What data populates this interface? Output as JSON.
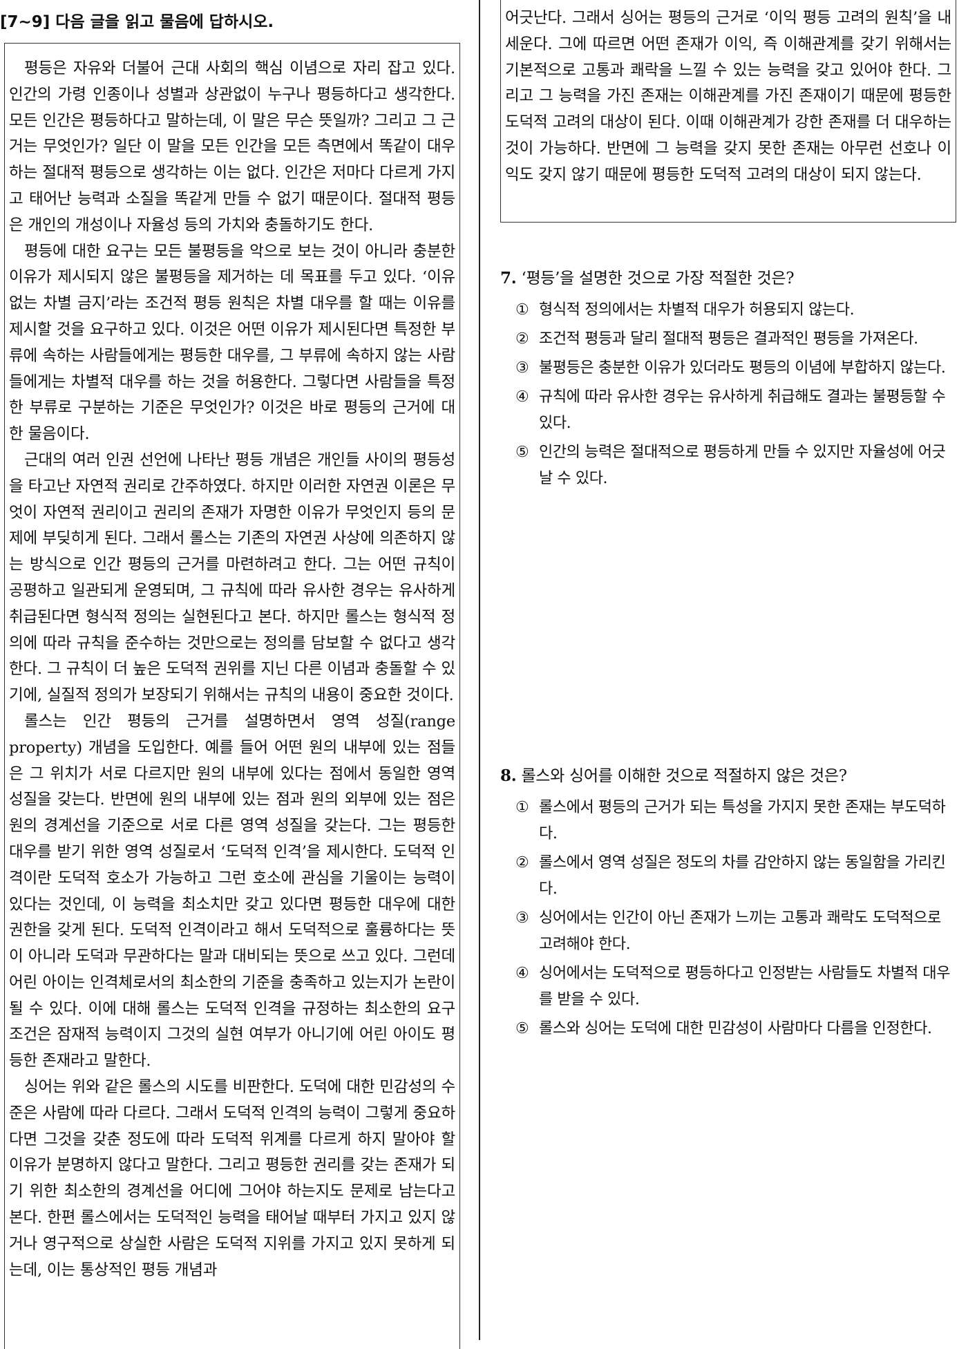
{
  "header": "[7~9] 다음 글을 읽고 물음에 답하시오.",
  "passage_left": [
    "평등은 자유와 더불어 근대 사회의 핵심 이념으로 자리 잡고 있다. 인간의 가령 인종이나 성별과 상관없이 누구나 평등하다고 생각한다. 모든 인간은 평등하다고 말하는데, 이 말은 무슨 뜻일까? 그리고 그 근거는 무엇인가? 일단 이 말을 모든 인간을 모든 측면에서 똑같이 대우하는 절대적 평등으로 생각하는 이는 없다. 인간은 저마다 다르게 가지고 태어난 능력과 소질을 똑같게 만들 수 없기 때문이다. 절대적 평등은 개인의 개성이나 자율성 등의 가치와 충돌하기도 한다.",
    "평등에 대한 요구는 모든 불평등을 악으로 보는 것이 아니라 충분한 이유가 제시되지 않은 불평등을 제거하는 데 목표를 두고 있다. ‘이유 없는 차별 금지’라는 조건적 평등 원칙은 차별 대우를 할 때는 이유를 제시할 것을 요구하고 있다. 이것은 어떤 이유가 제시된다면 특정한 부류에 속하는 사람들에게는 평등한 대우를, 그 부류에 속하지 않는 사람들에게는 차별적 대우를 하는 것을 허용한다. 그렇다면 사람들을 특정한 부류로 구분하는 기준은 무엇인가? 이것은 바로 평등의 근거에 대한 물음이다.",
    "근대의 여러 인권 선언에 나타난 평등 개념은 개인들 사이의 평등성을 타고난 자연적 권리로 간주하였다. 하지만 이러한 자연권 이론은 무엇이 자연적 권리이고 권리의 존재가 자명한 이유가 무엇인지 등의 문제에 부딪히게 된다. 그래서 롤스는 기존의 자연권 사상에 의존하지 않는 방식으로 인간 평등의 근거를 마련하려고 한다. 그는 어떤 규칙이 공평하고 일관되게 운영되며, 그 규칙에 따라 유사한 경우는 유사하게 취급된다면 형식적 정의는 실현된다고 본다. 하지만 롤스는 형식적 정의에 따라 규칙을 준수하는 것만으로는 정의를 담보할 수 없다고 생각한다. 그 규칙이 더 높은 도덕적 권위를 지닌 다른 이념과 충돌할 수 있기에, 실질적 정의가 보장되기 위해서는 규칙의 내용이 중요한 것이다.",
    "롤스는 인간 평등의 근거를 설명하면서 영역 성질(range property) 개념을 도입한다. 예를 들어 어떤 원의 내부에 있는 점들은 그 위치가 서로 다르지만 원의 내부에 있다는 점에서 동일한 영역 성질을 갖는다. 반면에 원의 내부에 있는 점과 원의 외부에 있는 점은 원의 경계선을 기준으로 서로 다른 영역 성질을 갖는다. 그는 평등한 대우를 받기 위한 영역 성질로서 ‘도덕적 인격’을 제시한다. 도덕적 인격이란 도덕적 호소가 가능하고 그런 호소에 관심을 기울이는 능력이 있다는 것인데, 이 능력을 최소치만 갖고 있다면 평등한 대우에 대한 권한을 갖게 된다. 도덕적 인격이라고 해서 도덕적으로 훌륭하다는 뜻이 아니라 도덕과 무관하다는 말과 대비되는 뜻으로 쓰고 있다. 그런데 어린 아이는 인격체로서의 최소한의 기준을 충족하고 있는지가 논란이 될 수 있다. 이에 대해 롤스는 도덕적 인격을 규정하는 최소한의 요구 조건은 잠재적 능력이지 그것의 실현 여부가 아니기에 어린 아이도 평등한 존재라고 말한다.",
    "싱어는 위와 같은 롤스의 시도를 비판한다. 도덕에 대한 민감성의 수준은 사람에 따라 다르다. 그래서 도덕적 인격의 능력이 그렇게 중요하다면 그것을 갖춘 정도에 따라 도덕적 위계를 다르게 하지 말아야 할 이유가 분명하지 않다고 말한다. 그리고 평등한 권리를 갖는 존재가 되기 위한 최소한의 경계선을 어디에 그어야 하는지도 문제로 남는다고 본다. 한편 롤스에서는 도덕적인 능력을 태어날 때부터 가지고 있지 않거나 영구적으로 상실한 사람은 도덕적 지위를 가지고 있지 못하게 되는데, 이는 통상적인 평등 개념과"
  ],
  "passage_right": "어긋난다. 그래서 싱어는 평등의 근거로 ‘이익 평등 고려의 원칙’을 내세운다. 그에 따르면 어떤 존재가 이익, 즉 이해관계를 갖기 위해서는 기본적으로 고통과 쾌락을 느낄 수 있는 능력을 갖고 있어야 한다. 그리고 그 능력을 가진 존재는 이해관계를 가진 존재이기 때문에 평등한 도덕적 고려의 대상이 된다. 이때 이해관계가 강한 존재를 더 대우하는 것이 가능하다. 반면에 그 능력을 갖지 못한 존재는 아무런 선호나 이익도 갖지 않기 때문에 평등한 도덕적 고려의 대상이 되지 않는다.",
  "questions": [
    {
      "number": "7.",
      "stem": "‘평등’을 설명한 것으로 가장 적절한 것은?",
      "choices": [
        {
          "mark": "①",
          "text": "형식적 정의에서는 차별적 대우가 허용되지 않는다."
        },
        {
          "mark": "②",
          "text": "조건적 평등과 달리 절대적 평등은 결과적인 평등을 가져온다."
        },
        {
          "mark": "③",
          "text": "불평등은 충분한 이유가 있더라도 평등의 이념에 부합하지 않는다."
        },
        {
          "mark": "④",
          "text": "규칙에 따라 유사한 경우는 유사하게 취급해도 결과는 불평등할 수 있다."
        },
        {
          "mark": "⑤",
          "text": "인간의 능력은 절대적으로 평등하게 만들 수 있지만 자율성에 어긋날 수 있다."
        }
      ]
    },
    {
      "number": "8.",
      "stem": "롤스와 싱어를 이해한 것으로 적절하지 않은 것은?",
      "choices": [
        {
          "mark": "①",
          "text": "롤스에서 평등의 근거가 되는 특성을 가지지 못한 존재는 부도덕하다."
        },
        {
          "mark": "②",
          "text": "롤스에서 영역 성질은 정도의 차를 감안하지 않는 동일함을 가리킨다."
        },
        {
          "mark": "③",
          "text": "싱어에서는 인간이 아닌 존재가 느끼는 고통과 쾌락도 도덕적으로 고려해야 한다."
        },
        {
          "mark": "④",
          "text": "싱어에서는 도덕적으로 평등하다고 인정받는 사람들도 차별적 대우를 받을 수 있다."
        },
        {
          "mark": "⑤",
          "text": "롤스와 싱어는 도덕에 대한 민감성이 사람마다 다름을 인정한다."
        }
      ]
    }
  ]
}
